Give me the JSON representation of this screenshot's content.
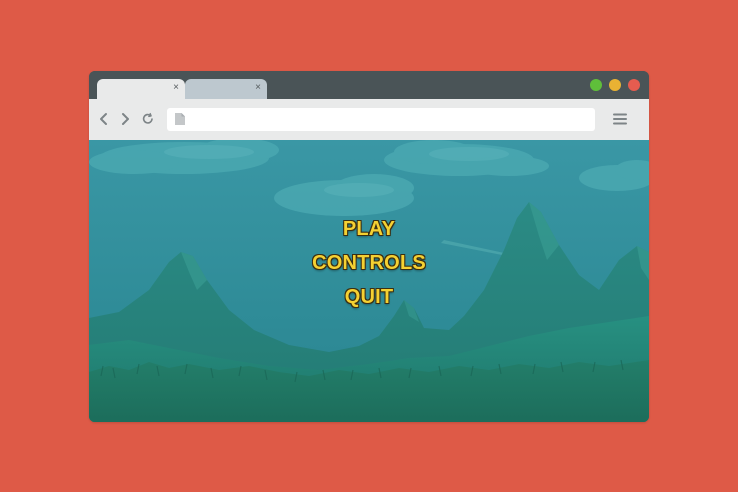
{
  "colors": {
    "page_background": "#de5a47",
    "browser_frame": "#4a5457",
    "toolbar": "#e9eaea",
    "menu_text": "#f5d132",
    "sky": "#2f8a97",
    "mountains": "#22786f"
  },
  "window_controls": [
    {
      "name": "maximize",
      "color": "#5fbf3a"
    },
    {
      "name": "minimize",
      "color": "#e9b233"
    },
    {
      "name": "close",
      "color": "#e65c4f"
    }
  ],
  "tabs": [
    {
      "close_glyph": "×",
      "active": true
    },
    {
      "close_glyph": "×",
      "active": false
    }
  ],
  "toolbar": {
    "back_icon": "chevron-left-icon",
    "forward_icon": "chevron-right-icon",
    "reload_icon": "reload-icon",
    "address_value": "",
    "menu_icon": "hamburger-menu-icon"
  },
  "game_menu": {
    "items": [
      "PLAY",
      "CONTROLS",
      "QUIT"
    ]
  }
}
